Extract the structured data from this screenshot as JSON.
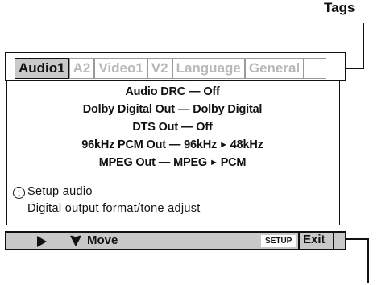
{
  "callout": {
    "label": "Tags"
  },
  "tabs": [
    {
      "label": "Audio1",
      "active": true
    },
    {
      "label": "A2",
      "active": false
    },
    {
      "label": "Video1",
      "active": false
    },
    {
      "label": "V2",
      "active": false
    },
    {
      "label": "Language",
      "active": false
    },
    {
      "label": "General",
      "active": false
    }
  ],
  "settings": [
    {
      "name": "Audio DRC",
      "value": "Off"
    },
    {
      "name": "Dolby Digital Out",
      "value": "Dolby Digital"
    },
    {
      "name": "DTS Out",
      "value": "Off"
    },
    {
      "name": "96kHz PCM Out",
      "value_from": "96kHz",
      "value_to": "48kHz"
    },
    {
      "name": "MPEG Out",
      "value_from": "MPEG",
      "value_to": "PCM"
    }
  ],
  "separator": "—",
  "arrow_glyph": "►",
  "info": {
    "icon": "info-icon",
    "line1": "Setup audio",
    "line2": "Digital output format/tone adjust"
  },
  "navbar": {
    "icons": [
      "arrow-right-icon",
      "arrow-down-icon"
    ],
    "move_label": "Move",
    "setup_key_label": "SETUP",
    "exit_label": "Exit"
  },
  "colors": {
    "active_tab_bg": "#c9c9c9",
    "inactive_tab_text": "#b8b8b8",
    "navbar_bg": "#c9c9c9"
  }
}
